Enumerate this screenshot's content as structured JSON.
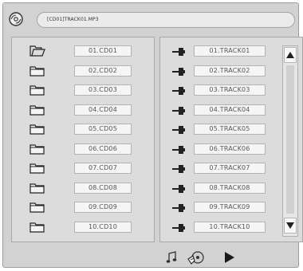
{
  "path_bar": {
    "text": "[CD01]TRACK01.MP3"
  },
  "folders": [
    {
      "label": "01.CD01",
      "open": true
    },
    {
      "label": "02.CD02",
      "open": false
    },
    {
      "label": "03.CD03",
      "open": false
    },
    {
      "label": "04.CD04",
      "open": false
    },
    {
      "label": "05.CD05",
      "open": false
    },
    {
      "label": "06.CD06",
      "open": false
    },
    {
      "label": "07.CD07",
      "open": false
    },
    {
      "label": "08.CD08",
      "open": false
    },
    {
      "label": "09.CD09",
      "open": false
    },
    {
      "label": "10.CD10",
      "open": false
    }
  ],
  "tracks": [
    {
      "label": "01.TRACK01"
    },
    {
      "label": "02.TRACK02"
    },
    {
      "label": "03.TRACK03"
    },
    {
      "label": "04.TRACK04"
    },
    {
      "label": "05.TRACK05"
    },
    {
      "label": "06.TRACK06"
    },
    {
      "label": "07.TRACK07"
    },
    {
      "label": "08.TRACK08"
    },
    {
      "label": "09.TRACK09"
    },
    {
      "label": "10.TRACK10"
    }
  ],
  "icons": {
    "disc": "disc-icon",
    "folder": "folder-icon",
    "track": "track-icon",
    "music": "music-note-icon",
    "hand": "hand-cursor-icon",
    "play": "play-icon"
  }
}
